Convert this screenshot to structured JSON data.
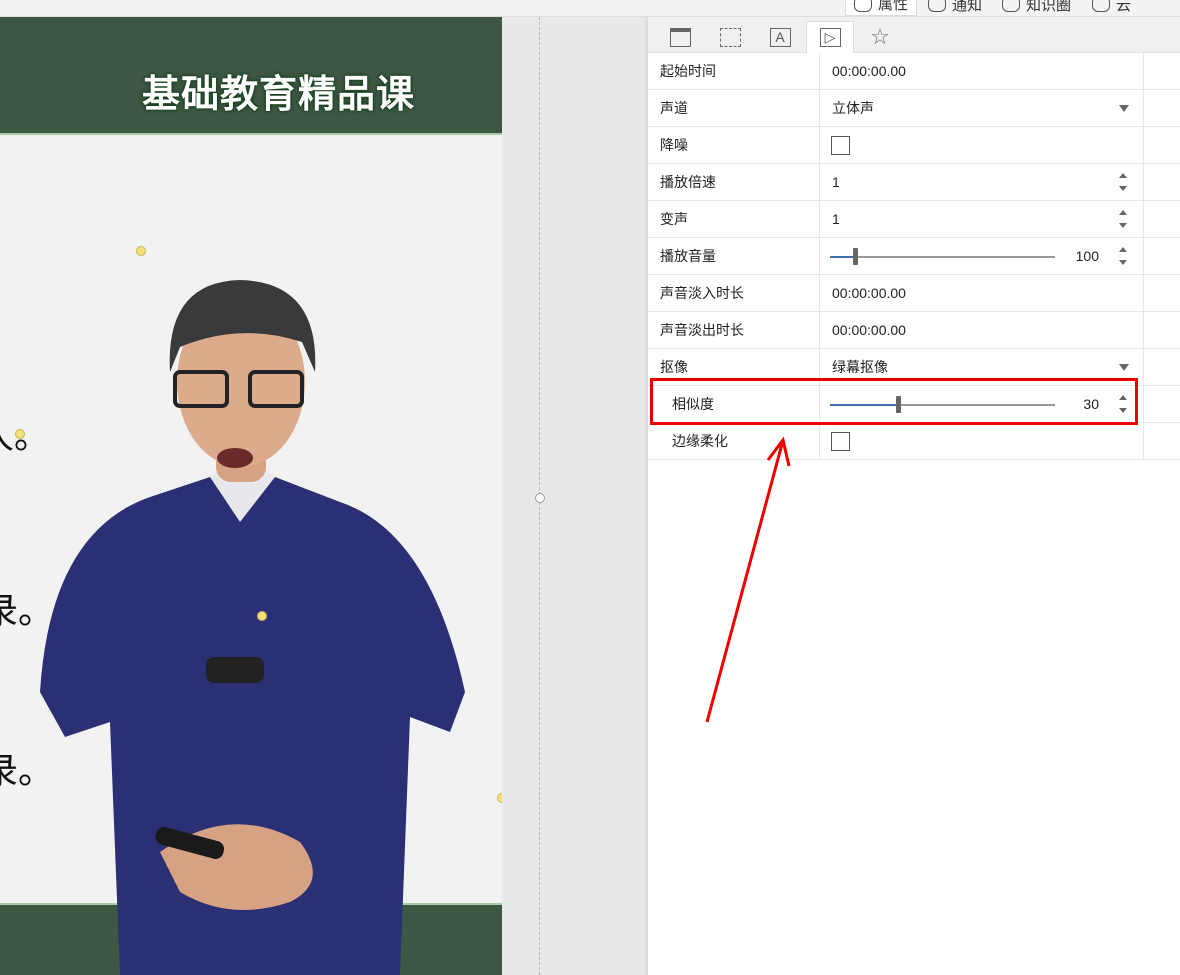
{
  "topbar": {
    "tabs": [
      {
        "label": "属性",
        "icon": "gear-icon"
      },
      {
        "label": "通知",
        "icon": "chat-icon"
      },
      {
        "label": "知识圈",
        "icon": "people-icon"
      },
      {
        "label": "云",
        "icon": "cloud-icon"
      }
    ]
  },
  "slide": {
    "title": "基础教育精品课",
    "fragments": [
      "人。",
      "录。",
      "录。"
    ]
  },
  "panel": {
    "tabs": [
      "layout-icon",
      "grid-icon",
      "text-icon",
      "media-play-icon",
      "animation-star-icon"
    ],
    "active_tab": 3,
    "rows": [
      {
        "label": "起始时间",
        "value": "00:00:00.00"
      },
      {
        "label": "声道",
        "value": "立体声"
      },
      {
        "label": "降噪",
        "checked": false
      },
      {
        "label": "播放倍速",
        "value": "1"
      },
      {
        "label": "变声",
        "value": "1"
      },
      {
        "label": "播放音量",
        "value": "100",
        "slider_fraction": 0.11
      },
      {
        "label": "声音淡入时长",
        "value": "00:00:00.00"
      },
      {
        "label": "声音淡出时长",
        "value": "00:00:00.00"
      },
      {
        "label": "抠像",
        "value": "绿幕抠像"
      },
      {
        "label": "相似度",
        "value": "30",
        "slider_fraction": 0.3
      },
      {
        "label": "边缘柔化",
        "checked": false
      }
    ]
  },
  "colors": {
    "highlight": "#e00000",
    "slide_band": "#3d5744"
  }
}
